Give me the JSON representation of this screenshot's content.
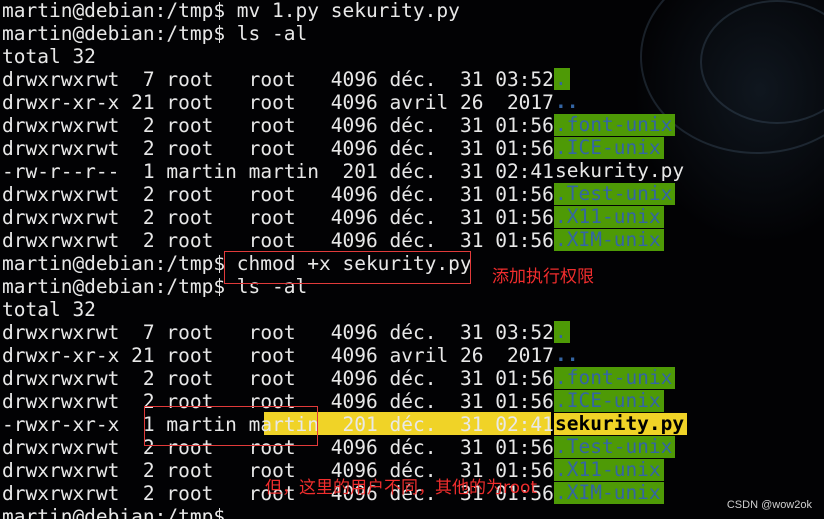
{
  "terminal": {
    "lines": [
      {
        "prompt": "martin@debian:/tmp$",
        "cmd": " mv 1.py sekurity.py"
      },
      {
        "prompt": "martin@debian:/tmp$",
        "cmd": " ls -al"
      },
      {
        "text": "total 32"
      },
      {
        "perm": "drwxrwxrwt",
        "links": " 7",
        "owner": "root  ",
        "group": "root  ",
        "size": "4096",
        "month": "déc. ",
        "day": "31",
        "time": "03:52",
        "name": "."
      },
      {
        "perm": "drwxr-xr-x",
        "links": "21",
        "owner": "root  ",
        "group": "root  ",
        "size": "4096",
        "month": "avril",
        "day": "26",
        "time": " 2017",
        "name": ".."
      },
      {
        "perm": "drwxrwxrwt",
        "links": " 2",
        "owner": "root  ",
        "group": "root  ",
        "size": "4096",
        "month": "déc. ",
        "day": "31",
        "time": "01:56",
        "name": ".font-unix"
      },
      {
        "perm": "drwxrwxrwt",
        "links": " 2",
        "owner": "root  ",
        "group": "root  ",
        "size": "4096",
        "month": "déc. ",
        "day": "31",
        "time": "01:56",
        "name": ".ICE-unix"
      },
      {
        "perm": "-rw-r--r--",
        "links": " 1",
        "owner": "martin",
        "group": "martin",
        "size": " 201",
        "month": "déc. ",
        "day": "31",
        "time": "02:41",
        "name": "sekurity.py"
      },
      {
        "perm": "drwxrwxrwt",
        "links": " 2",
        "owner": "root  ",
        "group": "root  ",
        "size": "4096",
        "month": "déc. ",
        "day": "31",
        "time": "01:56",
        "name": ".Test-unix"
      },
      {
        "perm": "drwxrwxrwt",
        "links": " 2",
        "owner": "root  ",
        "group": "root  ",
        "size": "4096",
        "month": "déc. ",
        "day": "31",
        "time": "01:56",
        "name": ".X11-unix"
      },
      {
        "perm": "drwxrwxrwt",
        "links": " 2",
        "owner": "root  ",
        "group": "root  ",
        "size": "4096",
        "month": "déc. ",
        "day": "31",
        "time": "01:56",
        "name": ".XIM-unix"
      },
      {
        "prompt": "martin@debian:/tmp$",
        "cmd": " chmod +x sekurity.py"
      },
      {
        "prompt": "martin@debian:/tmp$",
        "cmd": " ls -al"
      },
      {
        "text": "total 32"
      },
      {
        "perm": "drwxrwxrwt",
        "links": " 7",
        "owner": "root  ",
        "group": "root  ",
        "size": "4096",
        "month": "déc. ",
        "day": "31",
        "time": "03:52",
        "name": "."
      },
      {
        "perm": "drwxr-xr-x",
        "links": "21",
        "owner": "root  ",
        "group": "root  ",
        "size": "4096",
        "month": "avril",
        "day": "26",
        "time": " 2017",
        "name": ".."
      },
      {
        "perm": "drwxrwxrwt",
        "links": " 2",
        "owner": "root  ",
        "group": "root  ",
        "size": "4096",
        "month": "déc. ",
        "day": "31",
        "time": "01:56",
        "name": ".font-unix"
      },
      {
        "perm": "drwxrwxrwt",
        "links": " 2",
        "owner": "root  ",
        "group": "root  ",
        "size": "4096",
        "month": "déc. ",
        "day": "31",
        "time": "01:56",
        "name": ".ICE-unix"
      },
      {
        "perm": "-rwxr-xr-x",
        "links": " 1",
        "owner": "martin",
        "group": "martin",
        "size": " 201",
        "month": "déc. ",
        "day": "31",
        "time": "02:41",
        "name": "sekurity.py"
      },
      {
        "perm": "drwxrwxrwt",
        "links": " 2",
        "owner": "root  ",
        "group": "root  ",
        "size": "4096",
        "month": "déc. ",
        "day": "31",
        "time": "01:56",
        "name": ".Test-unix"
      },
      {
        "perm": "drwxrwxrwt",
        "links": " 2",
        "owner": "root  ",
        "group": "root  ",
        "size": "4096",
        "month": "déc. ",
        "day": "31",
        "time": "01:56",
        "name": ".X11-unix"
      },
      {
        "perm": "drwxrwxrwt",
        "links": " 2",
        "owner": "root  ",
        "group": "root  ",
        "size": "4096",
        "month": "déc. ",
        "day": "31",
        "time": "01:56",
        "name": ".XIM-unix"
      },
      {
        "prompt": "martin@debian:/tmp$",
        "cmd": ""
      }
    ]
  },
  "annotations": {
    "add_exec_permission": "添加执行权限",
    "user_note": "但，这里的用户不同，其他的为root"
  },
  "watermark": "CSDN @wow2ok",
  "colors": {
    "prompt": "#e8e8e8",
    "text": "#e8e8e8",
    "dir_bg": "#4e9a06",
    "dir_fg": "#3465a4",
    "exec_highlight": "#f0d327",
    "annotation": "#f02d2d"
  }
}
